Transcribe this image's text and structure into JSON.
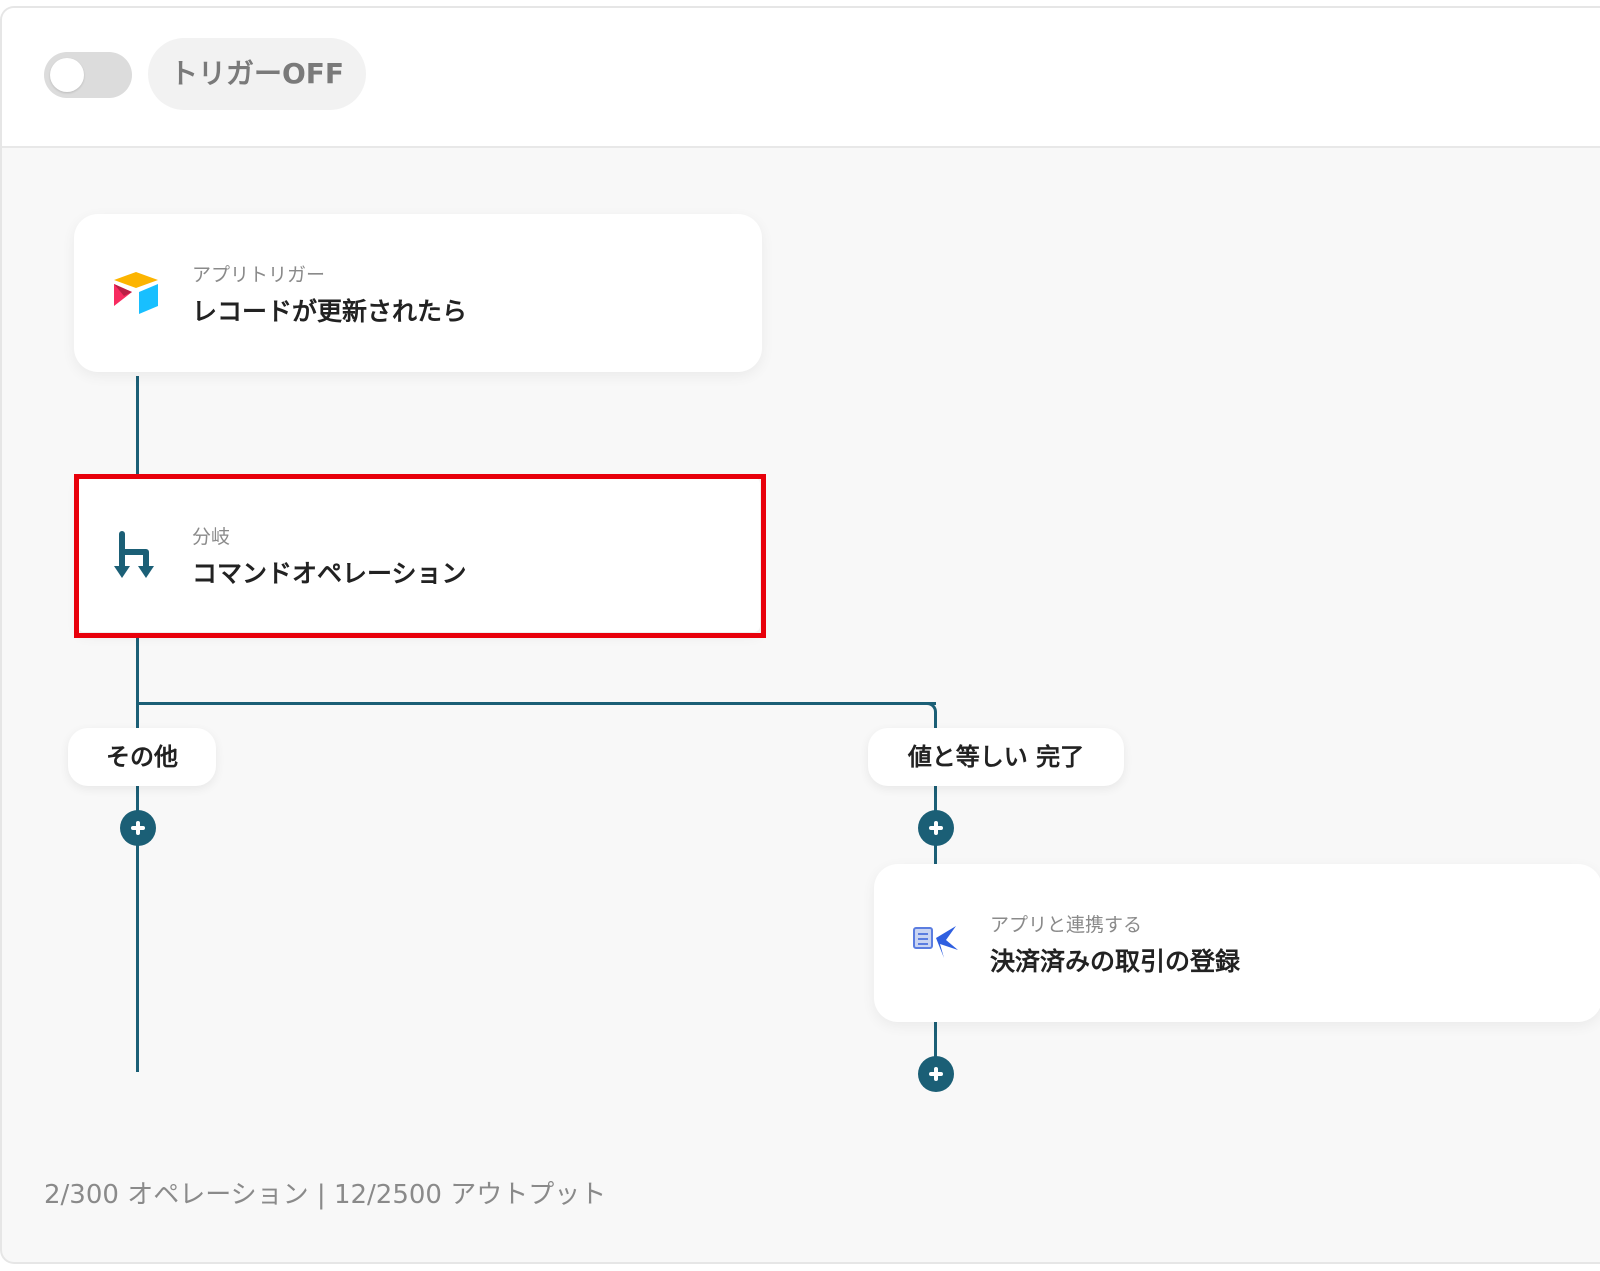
{
  "header": {
    "trigger_toggle_state": "off",
    "trigger_label": "トリガーOFF"
  },
  "flow": {
    "trigger_card": {
      "subtitle": "アプリトリガー",
      "title": "レコードが更新されたら",
      "icon": "airtable-logo-icon"
    },
    "branch_card": {
      "subtitle": "分岐",
      "title": "コマンドオペレーション",
      "icon": "branch-icon"
    },
    "branches": [
      {
        "label": "その他"
      },
      {
        "label": "値と等しい 完了"
      }
    ],
    "action_card": {
      "subtitle": "アプリと連携する",
      "title": "決済済みの取引の登録",
      "icon": "accounting-app-icon"
    }
  },
  "footer": {
    "usage": "2/300 オペレーション | 12/2500 アウトプット"
  },
  "colors": {
    "connector": "#1b5f76",
    "highlight": "#e8000b"
  }
}
